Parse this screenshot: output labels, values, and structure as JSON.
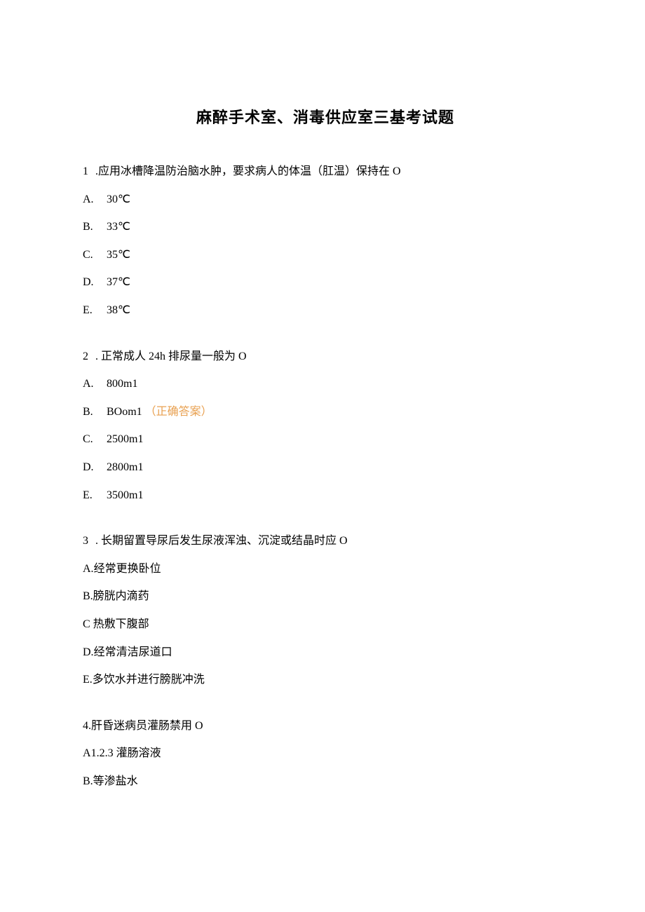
{
  "title": "麻醉手术室、消毒供应室三基考试题",
  "questions": [
    {
      "num": "1",
      "sep": " .",
      "text": "应用冰槽降温防治脑水肿，要求病人的体温（肛温）保持在 O",
      "options": [
        {
          "label": "A.",
          "text": "30℃"
        },
        {
          "label": "B.",
          "text": "33℃"
        },
        {
          "label": "C.",
          "text": "35℃"
        },
        {
          "label": "D.",
          "text": "37℃"
        },
        {
          "label": "E.",
          "text": "38℃"
        }
      ],
      "indented": true
    },
    {
      "num": "2",
      "sep": " . ",
      "text": "正常成人 24h 排尿量一般为 O",
      "options": [
        {
          "label": "A.",
          "text": "800m1"
        },
        {
          "label": "B.",
          "text": "BOom1",
          "answer": "（正确答案）"
        },
        {
          "label": "C.",
          "text": "2500m1"
        },
        {
          "label": "D.",
          "text": "2800m1"
        },
        {
          "label": "E.",
          "text": "3500m1"
        }
      ],
      "indented": true
    },
    {
      "num": "3",
      "sep": " . ",
      "text": "长期留置导尿后发生尿液浑浊、沉淀或结晶时应 O",
      "options": [
        {
          "label": "A.",
          "text": "经常更换卧位"
        },
        {
          "label": "B.",
          "text": "膀胱内滴药"
        },
        {
          "label": "C",
          "text": " 热敷下腹部"
        },
        {
          "label": "D.",
          "text": "经常清洁尿道口"
        },
        {
          "label": "E.",
          "text": "多饮水并进行膀胱冲洗"
        }
      ],
      "indented": false
    },
    {
      "num": "4.",
      "sep": "",
      "text": "肝昏迷病员灌肠禁用 O",
      "options": [
        {
          "label": "A",
          "text": "1.2.3 灌肠溶液"
        },
        {
          "label": "B.",
          "text": "等渗盐水"
        }
      ],
      "indented": false
    }
  ]
}
